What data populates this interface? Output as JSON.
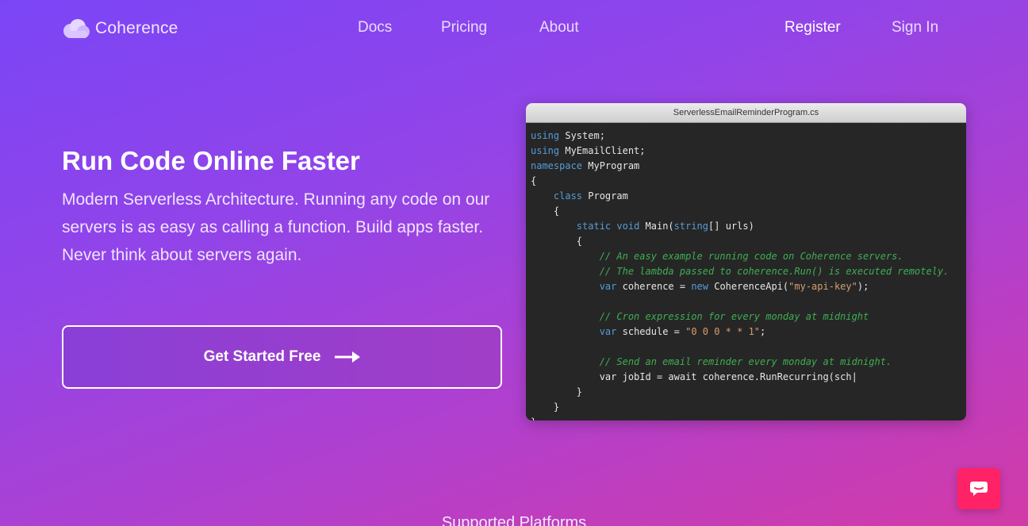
{
  "nav": {
    "brand": "Coherence",
    "links": [
      "Docs",
      "Pricing",
      "About"
    ],
    "register": "Register",
    "sign_in": "Sign In"
  },
  "hero": {
    "title": "Run Code Online Faster",
    "description": "Modern Serverless Architecture. Running any code on our servers is as easy as calling a function. Build apps faster. Never think about servers again.",
    "cta_label": "Get Started Free"
  },
  "editor": {
    "filename": "ServerlessEmailReminderProgram.cs",
    "lines": [
      [
        [
          "kw",
          "using"
        ],
        [
          "t",
          " System;"
        ]
      ],
      [
        [
          "kw",
          "using"
        ],
        [
          "t",
          " MyEmailClient;"
        ]
      ],
      [
        [
          "kw",
          "namespace"
        ],
        [
          "t",
          " MyProgram"
        ]
      ],
      [
        [
          "t",
          "{"
        ]
      ],
      [
        [
          "t",
          "    "
        ],
        [
          "kw",
          "class"
        ],
        [
          "t",
          " Program"
        ]
      ],
      [
        [
          "t",
          "    {"
        ]
      ],
      [
        [
          "t",
          "        "
        ],
        [
          "kw",
          "static"
        ],
        [
          "t",
          " "
        ],
        [
          "kw",
          "void"
        ],
        [
          "t",
          " Main("
        ],
        [
          "kw",
          "string"
        ],
        [
          "t",
          "[] urls)"
        ]
      ],
      [
        [
          "t",
          "        {"
        ]
      ],
      [
        [
          "t",
          "            "
        ],
        [
          "cm",
          "// An easy example running code on Coherence servers."
        ]
      ],
      [
        [
          "t",
          "            "
        ],
        [
          "cm",
          "// The lambda passed to coherence.Run() is executed remotely."
        ]
      ],
      [
        [
          "t",
          "            "
        ],
        [
          "kw",
          "var"
        ],
        [
          "t",
          " coherence = "
        ],
        [
          "kw",
          "new"
        ],
        [
          "t",
          " CoherenceApi("
        ],
        [
          "st",
          "\"my-api-key\""
        ],
        [
          "t",
          ");"
        ]
      ],
      [
        [
          "t",
          ""
        ]
      ],
      [
        [
          "t",
          "            "
        ],
        [
          "cm",
          "// Cron expression for every monday at midnight"
        ]
      ],
      [
        [
          "t",
          "            "
        ],
        [
          "kw",
          "var"
        ],
        [
          "t",
          " schedule = "
        ],
        [
          "st",
          "\"0 0 0 * * 1\""
        ],
        [
          "t",
          ";"
        ]
      ],
      [
        [
          "t",
          ""
        ]
      ],
      [
        [
          "t",
          "            "
        ],
        [
          "cm",
          "// Send an email reminder every monday at midnight."
        ]
      ],
      [
        [
          "t",
          "            var jobId = await coherence.RunRecurring(sch|"
        ]
      ],
      [
        [
          "t",
          "        }"
        ]
      ],
      [
        [
          "t",
          "    }"
        ]
      ],
      [
        [
          "t",
          "}"
        ]
      ]
    ]
  },
  "chat": {
    "icon": "chat-bubble-icon"
  },
  "footer": {
    "supported_platforms": "Supported Platforms"
  },
  "colors": {
    "accent": "#ff2266",
    "gradient_start": "#7b45f6",
    "gradient_end": "#d33aa7"
  }
}
